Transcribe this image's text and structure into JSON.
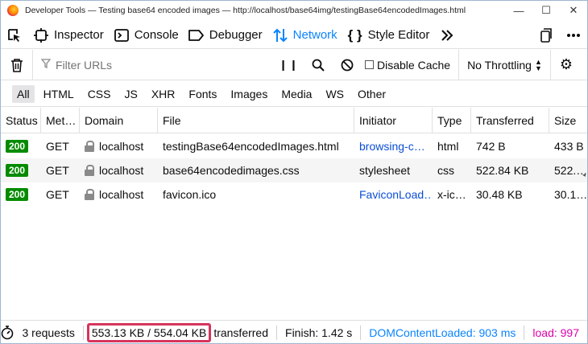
{
  "window": {
    "title": "Developer Tools — Testing base64 encoded images — http://localhost/base64img/testingBase64encodedImages.html",
    "buttons": {
      "minimize": "—",
      "maximize": "☐",
      "close": "✕"
    }
  },
  "toolbar": {
    "tabs": [
      {
        "label": "Inspector",
        "icon": "inspector-icon"
      },
      {
        "label": "Console",
        "icon": "console-icon"
      },
      {
        "label": "Debugger",
        "icon": "debugger-icon"
      },
      {
        "label": "Network",
        "icon": "network-icon"
      },
      {
        "label": "Style Editor",
        "icon": "style-editor-icon"
      }
    ],
    "active": "Network"
  },
  "filterbar": {
    "placeholder": "Filter URLs",
    "disable_cache_label": "Disable Cache",
    "throttling_label": "No Throttling"
  },
  "type_filters": [
    "All",
    "HTML",
    "CSS",
    "JS",
    "XHR",
    "Fonts",
    "Images",
    "Media",
    "WS",
    "Other"
  ],
  "table": {
    "headers": [
      "Status",
      "Met…",
      "Domain",
      "File",
      "Initiator",
      "Type",
      "Transferred",
      "Size"
    ],
    "rows": [
      {
        "status": "200",
        "method": "GET",
        "domain": "localhost",
        "file": "testingBase64encodedImages.html",
        "initiator": "browsing-c…",
        "type": "html",
        "transferred": "742 B",
        "size": "433 B"
      },
      {
        "status": "200",
        "method": "GET",
        "domain": "localhost",
        "file": "base64encodedimages.css",
        "initiator": "stylesheet",
        "type": "css",
        "transferred": "522.84 KB",
        "size": "522.…"
      },
      {
        "status": "200",
        "method": "GET",
        "domain": "localhost",
        "file": "favicon.ico",
        "initiator": "FaviconLoad…",
        "type": "x-ic…",
        "transferred": "30.48 KB",
        "size": "30.1…"
      }
    ]
  },
  "statusbar": {
    "requests": "3 requests",
    "size": "553.13 KB / 554.04 KB",
    "transferred": "transferred",
    "finish": "Finish: 1.42 s",
    "dom_content_loaded": "DOMContentLoaded: 903 ms",
    "load": "load: 997"
  },
  "colors": {
    "accent": "#0a84ff",
    "status_ok": "#058b00",
    "highlight_box": "#d6345c",
    "load": "#dd00a9"
  }
}
